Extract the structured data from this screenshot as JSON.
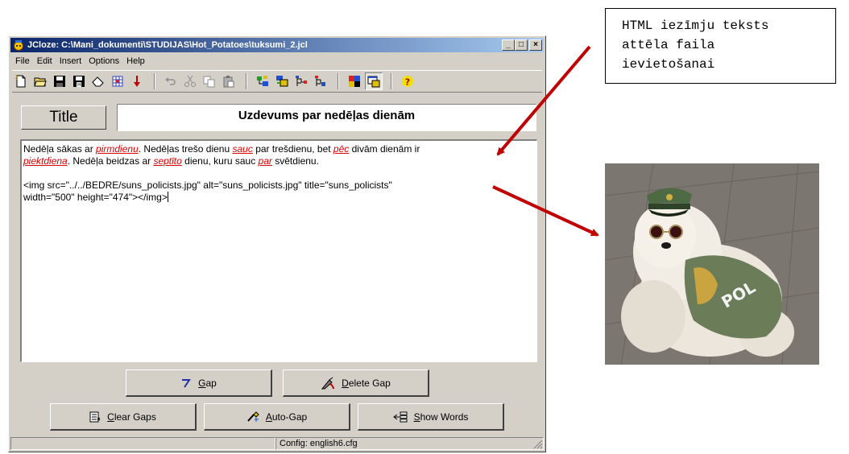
{
  "window": {
    "title": "JCloze: C:\\Mani_dokumenti\\STUDIJAS\\Hot_Potatoes\\tuksumi_2.jcl",
    "minimize": "_",
    "maximize": "□",
    "close": "×"
  },
  "menu": [
    "File",
    "Edit",
    "Insert",
    "Options",
    "Help"
  ],
  "toolbar": {
    "icons": [
      "new-file-icon",
      "open-folder-icon",
      "save-icon",
      "save-as-html-icon",
      "eraser-icon",
      "web-export-icon",
      "down-arrow-icon",
      "undo-icon",
      "cut-icon",
      "copy-icon",
      "paste-icon",
      "tree-icon-1",
      "tree-icon-2",
      "tree-icon-3",
      "tree-icon-4",
      "palette-icon",
      "window-icon",
      "help-icon"
    ]
  },
  "title_section": {
    "label": "Title",
    "value": "Uzdevums par nedēļas dienām"
  },
  "editor": {
    "line1": [
      {
        "t": "Nedēļa sākas ar ",
        "gap": false
      },
      {
        "t": "pirmdienu",
        "gap": true
      },
      {
        "t": ". Nedēļas trešo dienu ",
        "gap": false
      },
      {
        "t": "sauc",
        "gap": true
      },
      {
        "t": " par trešdienu, bet ",
        "gap": false
      },
      {
        "t": "pēc",
        "gap": true
      },
      {
        "t": " divām dienām ir",
        "gap": false
      }
    ],
    "line2": [
      {
        "t": "piektdiena",
        "gap": true
      },
      {
        "t": ". Nedēļa beidzas ar ",
        "gap": false
      },
      {
        "t": "septīto",
        "gap": true
      },
      {
        "t": " dienu, kuru sauc ",
        "gap": false
      },
      {
        "t": "par",
        "gap": true
      },
      {
        "t": " svētdienu.",
        "gap": false
      }
    ],
    "line3": "<img src=\"../../BEDRE/suns_policists.jpg\" alt=\"suns_policists.jpg\" title=\"suns_policists\"",
    "line4": "width=\"500\" height=\"474\"></img>"
  },
  "buttons": {
    "gap": {
      "accel": "G",
      "rest": "ap"
    },
    "delete_gap": {
      "accel": "D",
      "rest": "elete Gap"
    },
    "clear_gaps": {
      "accel": "C",
      "rest": "lear Gaps"
    },
    "auto_gap": {
      "accel": "A",
      "rest": "uto-Gap"
    },
    "show_words": {
      "accel": "S",
      "rest": "how Words"
    }
  },
  "statusbar": {
    "config": "Config: english6.cfg"
  },
  "callout": {
    "line1": "HTML iezīmju teksts",
    "line2": "attēla faila",
    "line3": "ievietošanai"
  },
  "colors": {
    "window_bg": "#d4d0c8",
    "title_gradient_start": "#0a246a",
    "title_gradient_end": "#a6caf0",
    "gap_text": "#e00000",
    "arrow": "#c00000"
  }
}
